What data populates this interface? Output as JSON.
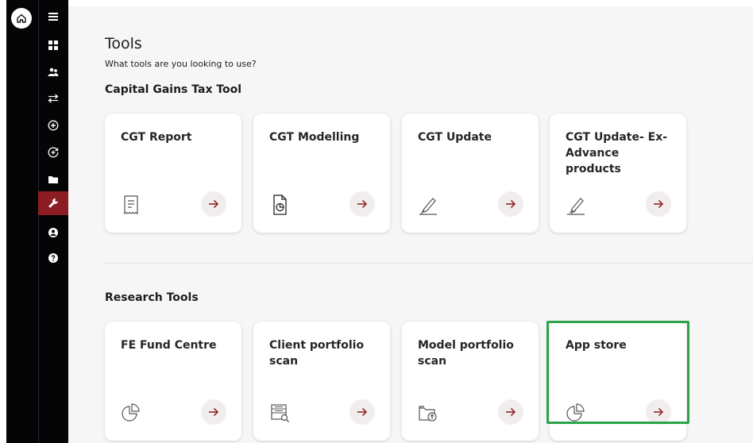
{
  "sidebar": {
    "items": [
      {
        "icon": "menu-icon"
      },
      {
        "icon": "dashboard-icon"
      },
      {
        "icon": "clients-icon"
      },
      {
        "icon": "transfer-icon"
      },
      {
        "icon": "add-circle-icon"
      },
      {
        "icon": "add-refresh-icon"
      },
      {
        "icon": "folder-icon"
      },
      {
        "icon": "wrench-icon",
        "active": true
      },
      {
        "icon": "user-icon"
      },
      {
        "icon": "help-icon"
      }
    ]
  },
  "page": {
    "title": "Tools",
    "subtitle": "What tools are you looking to use?"
  },
  "sections": [
    {
      "title": "Capital Gains Tax Tool",
      "cards": [
        {
          "title": "CGT Report",
          "icon": "receipt-icon"
        },
        {
          "title": "CGT Modelling",
          "icon": "document-chart-icon"
        },
        {
          "title": "CGT Update",
          "icon": "pen-edit-icon"
        },
        {
          "title": "CGT Update- Ex-Advance products",
          "icon": "pen-edit-icon"
        }
      ]
    },
    {
      "title": "Research Tools",
      "cards": [
        {
          "title": "FE Fund Centre",
          "icon": "pie-chart-icon"
        },
        {
          "title": "Client portfolio scan",
          "icon": "list-search-icon"
        },
        {
          "title": "Model portfolio scan",
          "icon": "folder-upload-icon"
        },
        {
          "title": "App store",
          "icon": "pie-chart-icon"
        }
      ]
    }
  ],
  "colors": {
    "accent": "#8c1d22",
    "sidebar": "#050505",
    "highlight": "#2aa34a",
    "arrow_bg": "#f1eded"
  }
}
